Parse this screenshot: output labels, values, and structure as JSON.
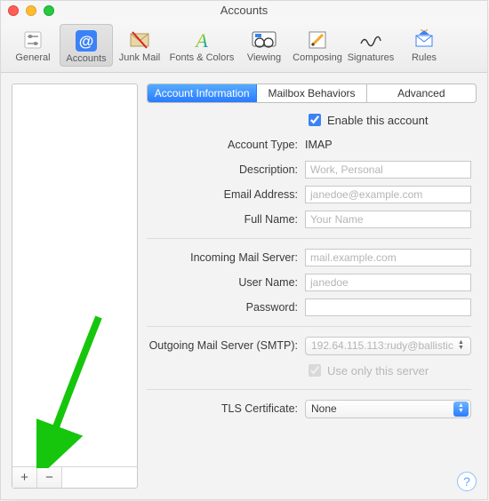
{
  "window": {
    "title": "Accounts"
  },
  "toolbar": {
    "items": [
      {
        "label": "General"
      },
      {
        "label": "Accounts"
      },
      {
        "label": "Junk Mail"
      },
      {
        "label": "Fonts & Colors"
      },
      {
        "label": "Viewing"
      },
      {
        "label": "Composing"
      },
      {
        "label": "Signatures"
      },
      {
        "label": "Rules"
      }
    ]
  },
  "tabs": {
    "items": [
      {
        "label": "Account Information"
      },
      {
        "label": "Mailbox Behaviors"
      },
      {
        "label": "Advanced"
      }
    ]
  },
  "form": {
    "enable_label": "Enable this account",
    "account_type_label": "Account Type:",
    "account_type_value": "IMAP",
    "description_label": "Description:",
    "description_placeholder": "Work, Personal",
    "email_label": "Email Address:",
    "email_placeholder": "janedoe@example.com",
    "fullname_label": "Full Name:",
    "fullname_placeholder": "Your Name",
    "incoming_label": "Incoming Mail Server:",
    "incoming_placeholder": "mail.example.com",
    "username_label": "User Name:",
    "username_placeholder": "janedoe",
    "password_label": "Password:",
    "smtp_label": "Outgoing Mail Server (SMTP):",
    "smtp_value": "192.64.115.113:rudy@ballistic",
    "use_only_label": "Use only this server",
    "tls_label": "TLS Certificate:",
    "tls_value": "None"
  },
  "sidebar": {
    "add": "+",
    "remove": "−"
  }
}
